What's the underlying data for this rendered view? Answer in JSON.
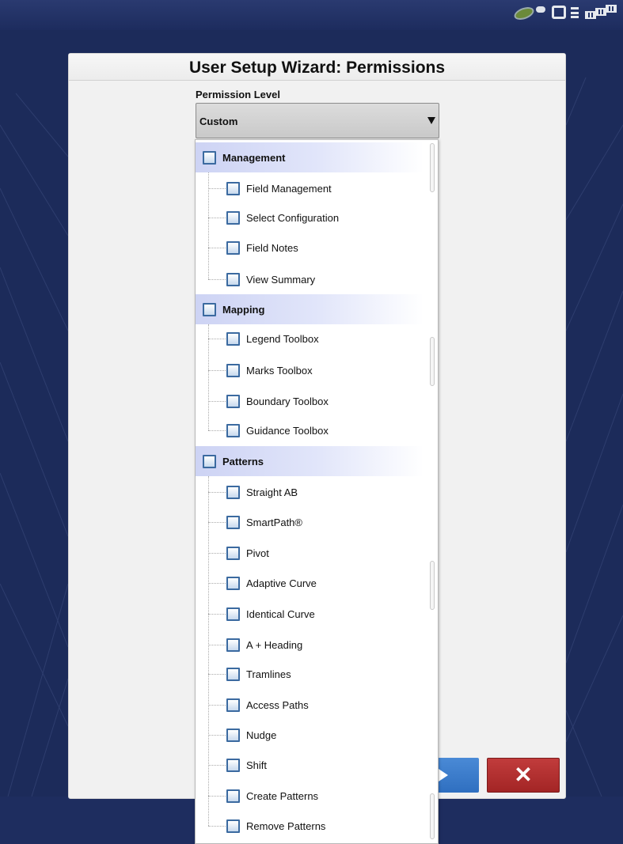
{
  "dialog": {
    "title": "User Setup Wizard: Permissions",
    "permission_label": "Permission Level",
    "permission_value": "Custom"
  },
  "buttons": {
    "cancel_symbol": "✕"
  },
  "groups": [
    {
      "label": "Management",
      "items": [
        "Field Management",
        "Select Configuration",
        "Field Notes",
        "View Summary"
      ]
    },
    {
      "label": "Mapping",
      "items": [
        "Legend Toolbox",
        "Marks Toolbox",
        "Boundary Toolbox",
        "Guidance Toolbox"
      ]
    },
    {
      "label": "Patterns",
      "items": [
        "Straight AB",
        "SmartPath®",
        "Pivot",
        "Adaptive Curve",
        "Identical Curve",
        "A + Heading",
        "Tramlines",
        "Access Paths",
        "Nudge",
        "Shift",
        "Create Patterns",
        "Remove Patterns"
      ]
    }
  ],
  "colors": {
    "background": "#1c2b5a",
    "next_button": "#3a7bcc",
    "cancel_button": "#b33131",
    "group_highlight": "#cdd3f4"
  },
  "icons": [
    "leaf-status-icon",
    "display-status-icon",
    "satellite-signal-icon",
    "dropdown-arrow-icon",
    "next-arrow-icon",
    "cancel-x-icon",
    "checkbox-icon"
  ]
}
